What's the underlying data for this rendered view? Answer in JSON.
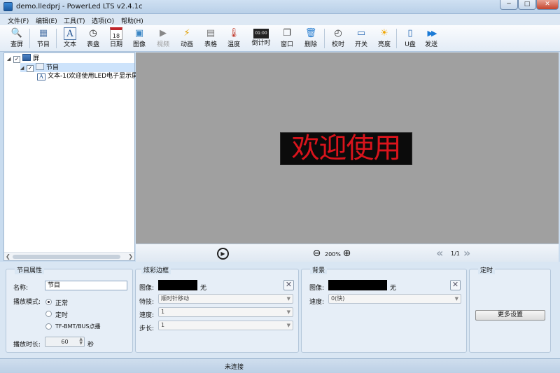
{
  "window": {
    "title": "demo.lledprj - PowerLed LTS v2.4.1c",
    "minimize": "─",
    "maximize": "□",
    "close": "✕"
  },
  "menu": [
    "文件(F)",
    "编辑(E)",
    "工具(T)",
    "选项(O)",
    "帮助(H)"
  ],
  "toolbar": [
    {
      "label": "查屏",
      "icon": "search-icon",
      "glyph": "🔍"
    },
    {
      "label": "节目",
      "icon": "program-icon",
      "glyph": "▦"
    },
    {
      "label": "文本",
      "icon": "text-icon",
      "glyph": "A"
    },
    {
      "label": "表盘",
      "icon": "clock-dial-icon",
      "glyph": "◷"
    },
    {
      "label": "日期",
      "icon": "calendar-icon",
      "glyph": "18"
    },
    {
      "label": "图像",
      "icon": "image-icon",
      "glyph": "▣"
    },
    {
      "label": "视频",
      "icon": "video-icon",
      "glyph": "▶",
      "disabled": true
    },
    {
      "label": "动画",
      "icon": "animation-icon",
      "glyph": "⚡"
    },
    {
      "label": "表格",
      "icon": "table-icon",
      "glyph": "▤"
    },
    {
      "label": "温度",
      "icon": "thermometer-icon",
      "glyph": "🌡"
    },
    {
      "label": "倒计时",
      "icon": "countdown-icon",
      "glyph": "01:00"
    },
    {
      "label": "窗口",
      "icon": "window-icon",
      "glyph": "❐"
    },
    {
      "label": "删除",
      "icon": "trash-icon",
      "glyph": "🗑"
    },
    {
      "label": "校时",
      "icon": "time-sync-icon",
      "glyph": "◴"
    },
    {
      "label": "开关",
      "icon": "monitor-power-icon",
      "glyph": "▭"
    },
    {
      "label": "亮度",
      "icon": "brightness-icon",
      "glyph": "☀"
    },
    {
      "label": "U盘",
      "icon": "usb-drive-icon",
      "glyph": "▯"
    },
    {
      "label": "发送",
      "icon": "send-icon",
      "glyph": "▶▶"
    }
  ],
  "tree": {
    "screen_label": "屏",
    "program_label": "节目",
    "text_label": "文本-1(欢迎使用LED电子显示屏",
    "screen_checked": "✓",
    "program_checked": "✓"
  },
  "preview": {
    "led_text": "欢迎使用",
    "zoom": "200%",
    "page": "1/1",
    "led_color": "#d8141c"
  },
  "program_props": {
    "title": "节目属性",
    "name_label": "名称:",
    "name_value": "节目",
    "mode_label": "播放模式:",
    "mode_options": [
      "正常",
      "定时",
      "TF-BMT/BUS点播"
    ],
    "selected_mode": "正常",
    "duration_label": "播放时长:",
    "duration_value": "60",
    "duration_unit": "秒"
  },
  "border_props": {
    "title": "炫彩边框",
    "image_label": "图像:",
    "image_value": "无",
    "effect_label": "特技:",
    "effect_value": "顺时针移动",
    "speed_label": "速度:",
    "speed_value": "1",
    "step_label": "步长:",
    "step_value": "1"
  },
  "background_props": {
    "title": "背景",
    "image_label": "图像:",
    "image_value": "无",
    "speed_label": "速度:",
    "speed_value": "0(快)"
  },
  "timing_props": {
    "title": "定时",
    "more_button": "更多设置"
  },
  "status": {
    "text": "未连接"
  }
}
